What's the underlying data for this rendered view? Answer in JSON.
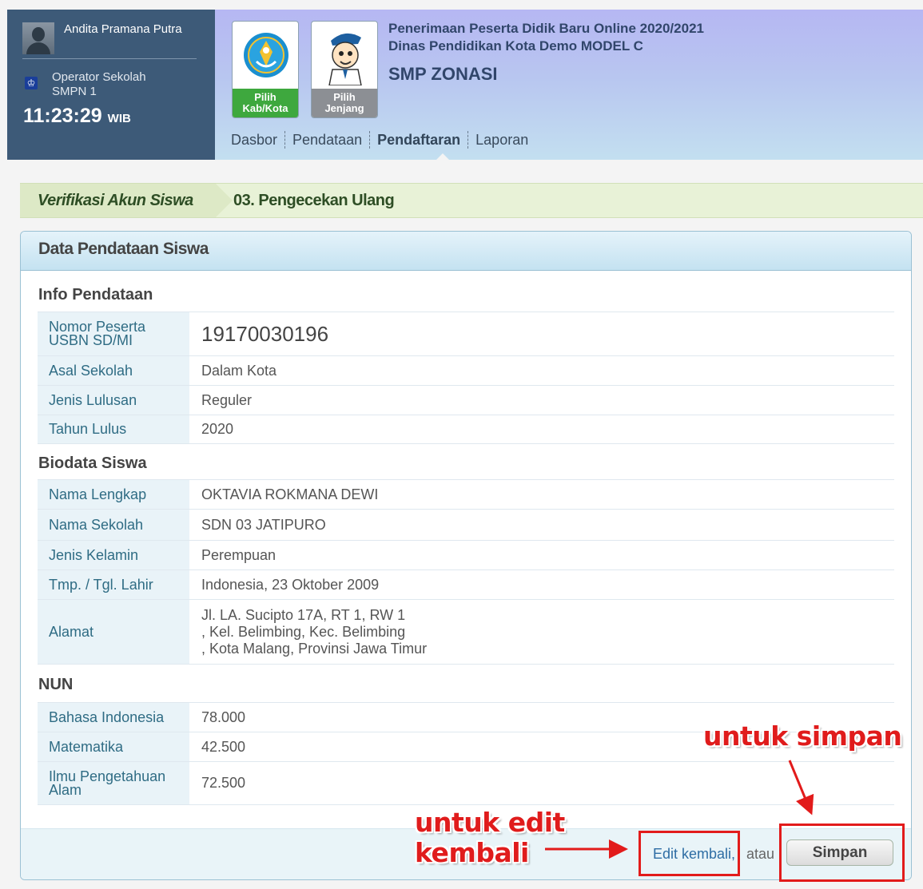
{
  "user": {
    "name": "Andita Pramana Putra",
    "role_line1": "Operator Sekolah",
    "role_line2": "SMPN 1",
    "time": "11:23:29",
    "timezone": "WIB"
  },
  "tiles": {
    "kab": {
      "line1": "Pilih",
      "line2": "Kab/Kota",
      "icon": "tut-wuri-handayani-logo"
    },
    "jenjang": {
      "line1": "Pilih",
      "line2": "Jenjang",
      "icon": "student-mascot"
    }
  },
  "banner": {
    "title_line1": "Penerimaan Peserta Didik Baru Online 2020/2021",
    "title_line2": "Dinas Pendidikan Kota Demo MODEL C",
    "subtitle": "SMP ZONASI"
  },
  "nav": {
    "items": [
      "Dasbor",
      "Pendataan",
      "Pendaftaran",
      "Laporan"
    ],
    "active": "Pendaftaran"
  },
  "breadcrumb": {
    "step1": "Verifikasi Akun Siswa",
    "step2": "03. Pengecekan Ulang"
  },
  "panel": {
    "title": "Data Pendataan Siswa",
    "info": {
      "title": "Info Pendataan",
      "rows": [
        {
          "label": "Nomor Peserta USBN SD/MI",
          "value": "19170030196"
        },
        {
          "label": "Asal Sekolah",
          "value": "Dalam Kota"
        },
        {
          "label": "Jenis Lulusan",
          "value": "Reguler"
        },
        {
          "label": "Tahun Lulus",
          "value": "2020"
        }
      ]
    },
    "bio": {
      "title": "Biodata Siswa",
      "rows": [
        {
          "label": "Nama Lengkap",
          "value": "OKTAVIA ROKMANA DEWI"
        },
        {
          "label": "Nama Sekolah",
          "value": "SDN 03 JATIPURO"
        },
        {
          "label": "Jenis Kelamin",
          "value": "Perempuan"
        },
        {
          "label": "Tmp. / Tgl. Lahir",
          "value": "Indonesia, 23 Oktober 2009"
        },
        {
          "label": "Alamat",
          "value_line1": "Jl. LA. Sucipto 17A, RT 1, RW 1",
          "value_line2": ", Kel. Belimbing, Kec. Belimbing",
          "value_line3": ", Kota Malang, Provinsi Jawa Timur"
        }
      ]
    },
    "nun": {
      "title": "NUN",
      "rows": [
        {
          "label": "Bahasa Indonesia",
          "value": "78.000"
        },
        {
          "label": "Matematika",
          "value": "42.500"
        },
        {
          "label": "Ilmu Pengetahuan Alam",
          "value": "72.500"
        }
      ]
    },
    "footer": {
      "edit_label": "Edit kembali,",
      "or_label": "atau",
      "save_label": "Simpan"
    }
  },
  "annotations": {
    "save_hint": "untuk simpan",
    "edit_hint_line1": "untuk edit",
    "edit_hint_line2": "kembali",
    "color": "#e21b1b"
  }
}
